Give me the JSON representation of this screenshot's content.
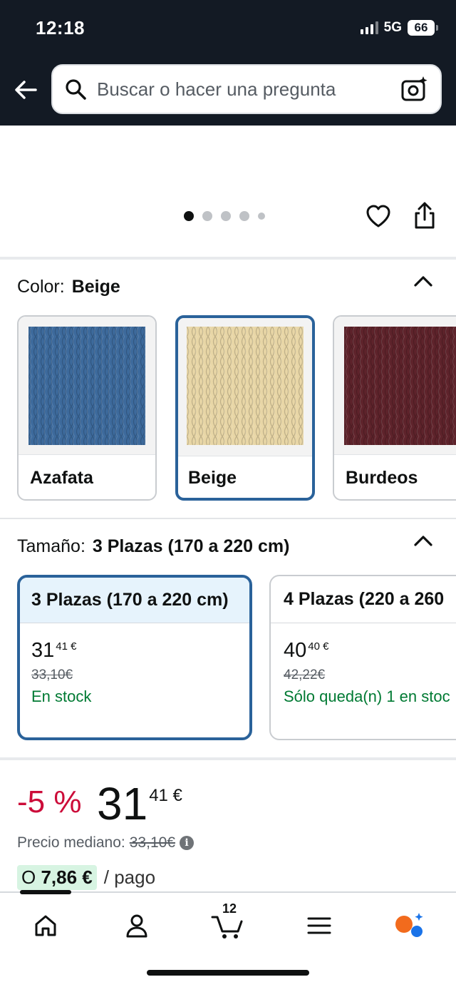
{
  "status_bar": {
    "time": "12:18",
    "network": "5G",
    "battery": "66"
  },
  "search": {
    "placeholder": "Buscar o hacer una pregunta"
  },
  "color": {
    "label": "Color:",
    "selected": "Beige",
    "options": [
      {
        "name": "Azafata",
        "color": "#3d6a9c"
      },
      {
        "name": "Beige",
        "color": "#e8d6a6"
      },
      {
        "name": "Burdeos",
        "color": "#5e232b"
      }
    ]
  },
  "size": {
    "label": "Tamaño:",
    "selected": "3 Plazas (170 a 220 cm)",
    "options": [
      {
        "name": "3 Plazas (170 a 220 cm)",
        "price_whole": "31",
        "price_fraction": "41 €",
        "old_price": "33,10€",
        "stock": "En stock"
      },
      {
        "name": "4 Plazas (220 a 260",
        "price_whole": "40",
        "price_fraction": "40 €",
        "old_price": "42,22€",
        "stock": "Sólo queda(n) 1 en stoc"
      }
    ]
  },
  "price": {
    "discount": "-5 %",
    "whole": "31",
    "fraction": "41 €",
    "median_label": "Precio mediano:",
    "median_value": "33,10€",
    "installment_prefix": "O",
    "installment_amount": "7,86 €",
    "installment_suffix": "/ pago"
  },
  "nav": {
    "cart_count": "12"
  },
  "colors": {
    "header_bg": "#131a24",
    "selected_border": "#2a629a",
    "discount": "#cc0c39",
    "stock": "#007a33"
  }
}
